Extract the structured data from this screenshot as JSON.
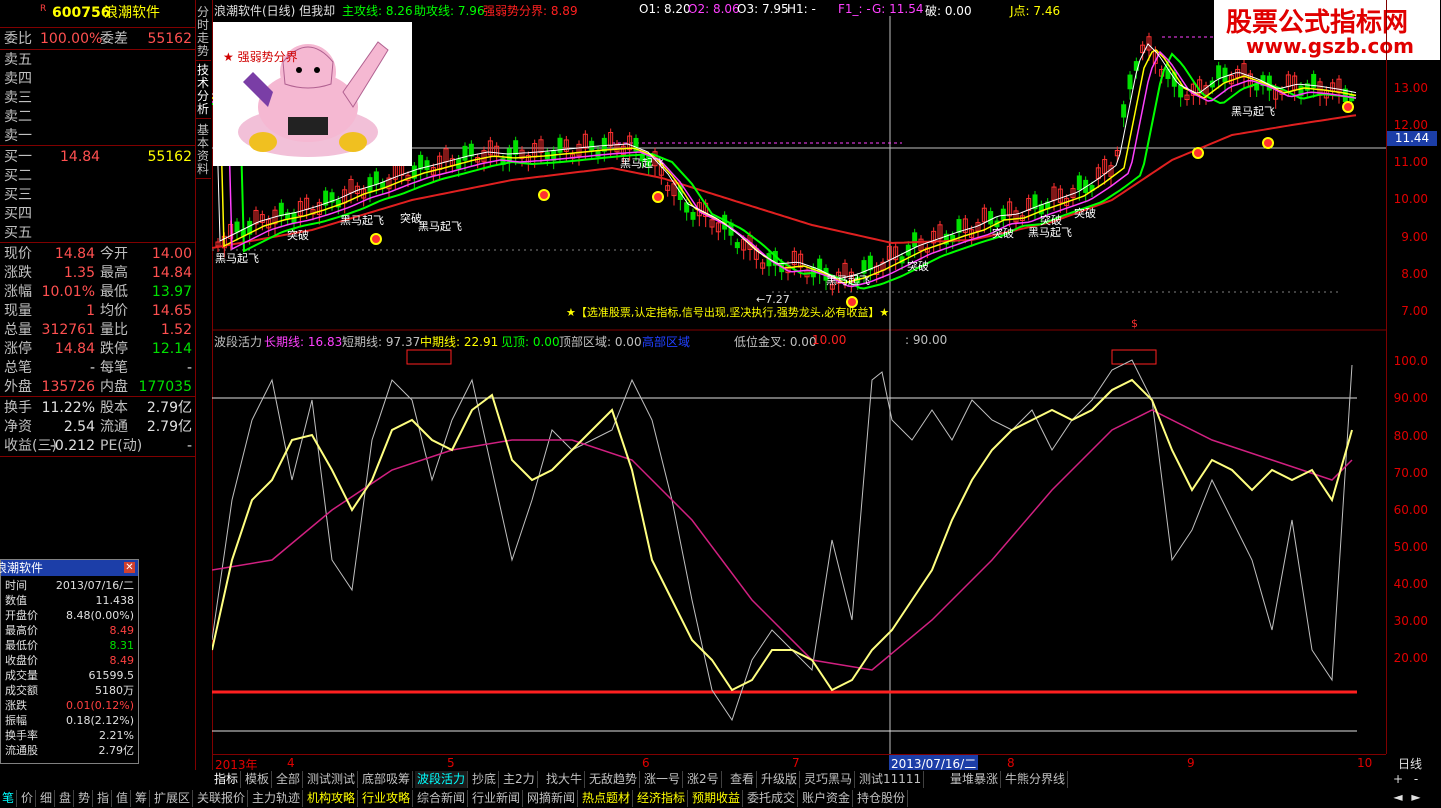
{
  "stock": {
    "flag": "R",
    "code": "600756",
    "name": "浪潮软件"
  },
  "quote": {
    "weibi_label": "委比",
    "weibi_val": "100.00%",
    "weicha_label": "委差",
    "weicha_val": "55162",
    "sell": [
      {
        "l": "卖五"
      },
      {
        "l": "卖四"
      },
      {
        "l": "卖三"
      },
      {
        "l": "卖二"
      },
      {
        "l": "卖一"
      }
    ],
    "buy": [
      {
        "l": "买一",
        "p": "14.84",
        "v": "55162"
      },
      {
        "l": "买二"
      },
      {
        "l": "买三"
      },
      {
        "l": "买四"
      },
      {
        "l": "买五"
      }
    ],
    "rows": [
      {
        "a": "现价",
        "av": "14.84",
        "b": "今开",
        "bv": "14.00"
      },
      {
        "a": "涨跌",
        "av": "1.35",
        "b": "最高",
        "bv": "14.84"
      },
      {
        "a": "涨幅",
        "av": "10.01%",
        "b": "最低",
        "bv": "13.97"
      },
      {
        "a": "现量",
        "av": "1",
        "b": "均价",
        "bv": "14.65"
      },
      {
        "a": "总量",
        "av": "312761",
        "b": "量比",
        "bv": "1.52"
      },
      {
        "a": "涨停",
        "av": "14.84",
        "b": "跌停",
        "bv": "12.14"
      },
      {
        "a": "总笔",
        "av": "-",
        "b": "每笔",
        "bv": "-"
      },
      {
        "a": "外盘",
        "av": "135726",
        "b": "内盘",
        "bv": "177035"
      }
    ],
    "rows2": [
      {
        "a": "换手",
        "av": "11.22%",
        "b": "股本",
        "bv": "2.79亿"
      },
      {
        "a": "净资",
        "av": "2.54",
        "b": "流通",
        "bv": "2.79亿"
      },
      {
        "a": "收益(三)",
        "av": "-0.212",
        "b": "PE(动)",
        "bv": "-"
      }
    ]
  },
  "sidetabs": [
    "分时走势",
    "技术分析",
    "基本资料"
  ],
  "header": {
    "title": "浪潮软件(日线) 但我却",
    "items": [
      {
        "t": "主攻线: 8.26",
        "c": "#00ff00"
      },
      {
        "t": "助攻线: 7.96",
        "c": "#00ff00"
      },
      {
        "t": "强弱势分界: 8.89",
        "c": "#ff2020"
      },
      {
        "t": "O1: 8.20",
        "c": "#ffffff"
      },
      {
        "t": "O2: 8.06",
        "c": "#ff40ff"
      },
      {
        "t": "O3: 7.95",
        "c": "#ffffff"
      },
      {
        "t": "H1: -",
        "c": "#ffffff"
      },
      {
        "t": "F1_: -",
        "c": "#ff40ff"
      },
      {
        "t": "G: 11.54",
        "c": "#ff40ff"
      },
      {
        "t": "破: 0.00",
        "c": "#ffffff"
      },
      {
        "t": "J点: 7.46",
        "c": "#ffff00"
      }
    ]
  },
  "pic_caption": "★ 强弱势分界",
  "logo": {
    "line1": "股票公式指标网",
    "line2": "www.gszb.com"
  },
  "price_axis": [
    "13.00",
    "12.00",
    "11.00",
    "10.00",
    "9.00",
    "8.00",
    "7.00"
  ],
  "price_current": "11.44",
  "ind_axis": [
    "100.0",
    "90.00",
    "80.00",
    "70.00",
    "60.00",
    "50.00",
    "40.00",
    "30.00",
    "20.00"
  ],
  "indicator_header": {
    "name": "波段活力",
    "items": [
      {
        "t": "长期线: 16.83",
        "c": "#ff40ff"
      },
      {
        "t": "短期线: 97.37",
        "c": "#c0c0c0"
      },
      {
        "t": "中期线: 22.91",
        "c": "#ffff00"
      },
      {
        "t": "见顶: 0.00",
        "c": "#00ff00"
      },
      {
        "t": "顶部区域: 0.00",
        "c": "#c0c0c0"
      },
      {
        "t": "高部区域",
        "c": "#2040ff"
      },
      {
        "t": "低位金叉: 0.00",
        "c": "#c0c0c0"
      },
      {
        "t": "10.00",
        "c": "#ff2020"
      },
      {
        "t": ": 90.00",
        "c": "#c0c0c0"
      }
    ]
  },
  "banner": "★【选准股票,认定指标,信号出现,坚决执行,强势龙头,必有收益】★",
  "low_label": "←7.27",
  "signal_labels": [
    "黑马起飞",
    "突破",
    "黑马起飞",
    "突破",
    "黑马起飞",
    "黑马起飞",
    "突破",
    "黑马起飞",
    "突破",
    "突破",
    "黑马起飞",
    "突破",
    "黑马起飞"
  ],
  "dollar": "$",
  "xaxis": {
    "year": "2013年",
    "months": [
      "4",
      "5",
      "6",
      "7",
      "8",
      "9",
      "10"
    ],
    "cursor_date": "2013/07/16/二",
    "period": "日线"
  },
  "infobox": {
    "title": "浪潮软件",
    "rows": [
      {
        "k": "时间",
        "v": "2013/07/16/二",
        "c": "#e0e0e0"
      },
      {
        "k": "数值",
        "v": "11.438",
        "c": "#e0e0e0"
      },
      {
        "k": "开盘价",
        "v": "8.48(0.00%)",
        "c": "#e0e0e0"
      },
      {
        "k": "最高价",
        "v": "8.49",
        "c": "#ff4040"
      },
      {
        "k": "最低价",
        "v": "8.31",
        "c": "#00e000"
      },
      {
        "k": "收盘价",
        "v": "8.49",
        "c": "#ff4040"
      },
      {
        "k": "成交量",
        "v": "61599.5",
        "c": "#e0e0e0"
      },
      {
        "k": "成交额",
        "v": "5180万",
        "c": "#e0e0e0"
      },
      {
        "k": "涨跌",
        "v": "0.01(0.12%)",
        "c": "#ff4040"
      },
      {
        "k": "振幅",
        "v": "0.18(2.12%)",
        "c": "#e0e0e0"
      },
      {
        "k": "换手率",
        "v": "2.21%",
        "c": "#e0e0e0"
      },
      {
        "k": "流通股",
        "v": "2.79亿",
        "c": "#e0e0e0"
      }
    ]
  },
  "tabs1": [
    "指标",
    "模板",
    "全部",
    "测试测试",
    "底部吸筹",
    "波段活力",
    "抄底",
    "主2力",
    "找大牛",
    "无敌趋势",
    "涨一号",
    "涨2号",
    "查看",
    "升级版",
    "灵巧黑马",
    "测试11111",
    "量堆暴涨",
    "牛熊分界线"
  ],
  "tabs2": [
    "笔",
    "价",
    "细",
    "盘",
    "势",
    "指",
    "值",
    "筹",
    "扩展区",
    "关联报价",
    "主力轨迹",
    "机构攻略",
    "行业攻略",
    "综合新闻",
    "行业新闻",
    "网摘新闻",
    "热点题材",
    "经济指标",
    "预期收益",
    "委托成交",
    "账户资金",
    "持仓股份"
  ],
  "nav": [
    "+",
    "-",
    "◄",
    "►"
  ],
  "colors": {
    "up": "#ff3030",
    "down": "#00e000",
    "axis_red": "#800000"
  }
}
